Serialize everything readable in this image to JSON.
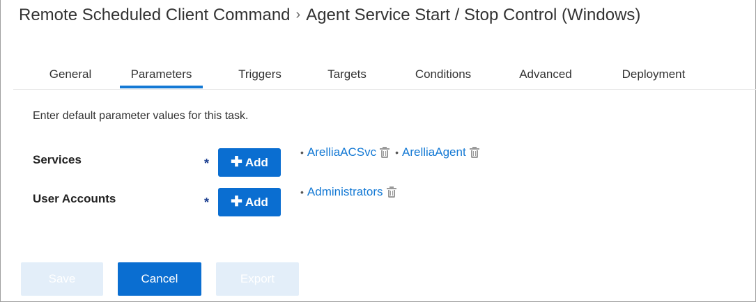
{
  "breadcrumb": {
    "parent": "Remote Scheduled Client Command",
    "separator": "›",
    "current": "Agent Service Start / Stop Control (Windows)"
  },
  "tabs": [
    {
      "label": "General",
      "active": false
    },
    {
      "label": "Parameters",
      "active": true
    },
    {
      "label": "Triggers",
      "active": false
    },
    {
      "label": "Targets",
      "active": false
    },
    {
      "label": "Conditions",
      "active": false
    },
    {
      "label": "Advanced",
      "active": false
    },
    {
      "label": "Deployment",
      "active": false
    }
  ],
  "intro_text": "Enter default parameter values for this task.",
  "parameters": [
    {
      "label": "Services",
      "required_marker": "*",
      "add_label": "Add",
      "values": [
        "ArelliaACSvc",
        "ArelliaAgent"
      ]
    },
    {
      "label": "User Accounts",
      "required_marker": "*",
      "add_label": "Add",
      "values": [
        "Administrators"
      ]
    }
  ],
  "bullet": "•",
  "icons": {
    "add": "plus-icon",
    "delete": "trash-icon"
  },
  "footer": {
    "save_label": "Save",
    "cancel_label": "Cancel",
    "export_label": "Export"
  },
  "colors": {
    "accent": "#0a6ed1",
    "link": "#1479d4",
    "disabled_button": "#e3eef9",
    "required": "#1a3d8f"
  }
}
